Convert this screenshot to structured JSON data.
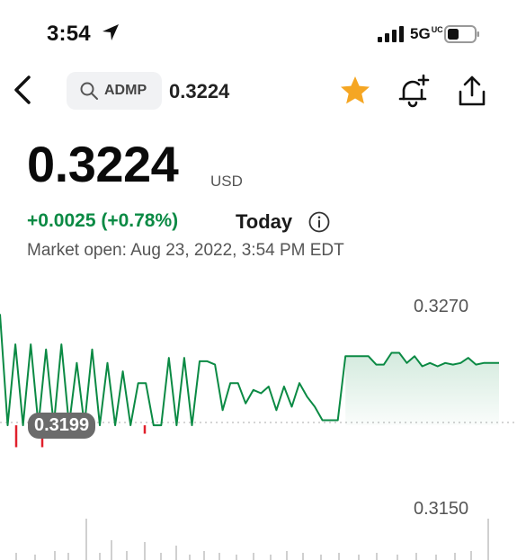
{
  "status_bar": {
    "time": "3:54",
    "network": "5G",
    "network_suffix": "UC"
  },
  "header": {
    "ticker": "ADMP",
    "price": "0.3224"
  },
  "quote": {
    "price": "0.3224",
    "currency": "USD",
    "change": "+0.0025 (+0.78%)",
    "period": "Today",
    "market_status": "Market open: Aug 23, 2022, 3:54 PM EDT"
  },
  "colors": {
    "up": "#0b8a44",
    "down": "#e0202c",
    "star": "#f5a623"
  },
  "chart_data": {
    "type": "line",
    "y_ticks": [
      "0.3270",
      "0.3150"
    ],
    "previous_close": "0.3199",
    "series": [
      {
        "values": [
          0.3265,
          0.3199,
          0.3247,
          0.3199,
          0.3247,
          0.3199,
          0.3244,
          0.3199,
          0.3247,
          0.3199,
          0.3236,
          0.3199,
          0.3244,
          0.3199,
          0.3236,
          0.3199,
          0.3231,
          0.3199,
          0.3224,
          0.3224,
          0.3199,
          0.3199,
          0.3239,
          0.3199,
          0.3239,
          0.3199,
          0.3237,
          0.3237,
          0.3235,
          0.3208,
          0.3224,
          0.3224,
          0.3212,
          0.322,
          0.3218,
          0.3222,
          0.3208,
          0.3222,
          0.321,
          0.3224,
          0.3216,
          0.321,
          0.3202,
          0.3202,
          0.3202,
          0.324,
          0.324,
          0.324,
          0.324,
          0.3235,
          0.3235,
          0.3242,
          0.3242,
          0.3236,
          0.324,
          0.3234,
          0.3236,
          0.3234,
          0.3236,
          0.3235,
          0.3236,
          0.3239,
          0.3235,
          0.3236,
          0.3236,
          0.3236
        ],
        "dips": [
          0.3186,
          0.3186,
          0.3194
        ]
      }
    ]
  }
}
